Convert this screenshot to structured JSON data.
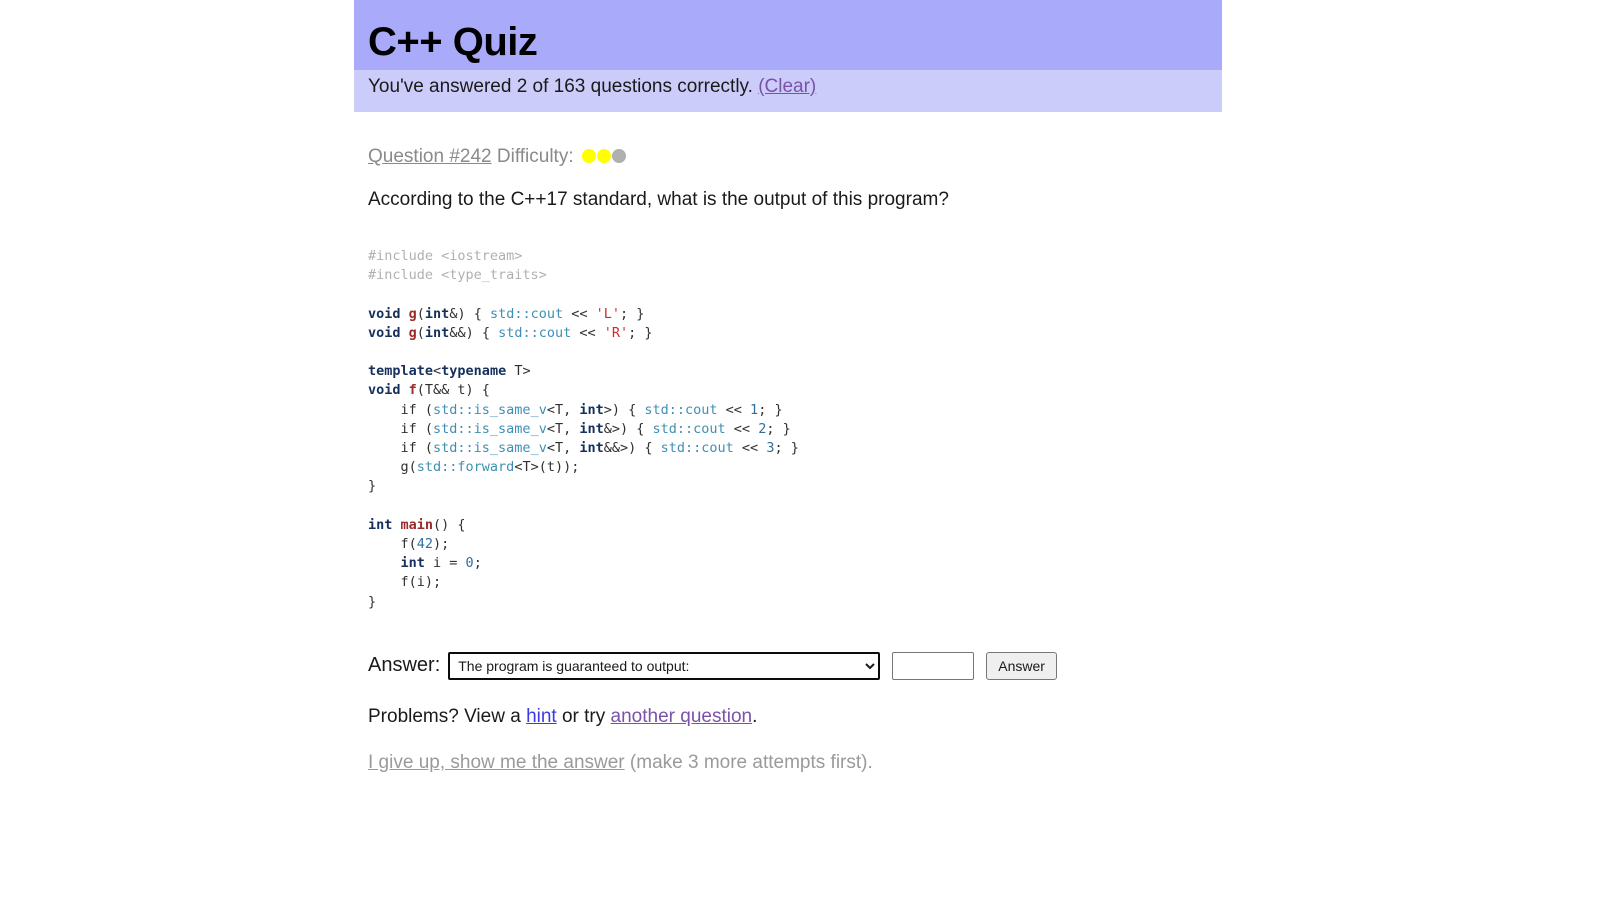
{
  "header": {
    "title": "C++ Quiz",
    "status_prefix": "You've answered 2 of 163 questions correctly.",
    "clear_label": "(Clear)",
    "correct_count": "2",
    "total_count": "163",
    "title_bg": "#aaaafa",
    "status_bg": "#ccccfa"
  },
  "question": {
    "link_label": "Question #242",
    "number": "242",
    "difficulty_label": "Difficulty:",
    "difficulty_filled": 2,
    "difficulty_total": 3,
    "difficulty_on_color": "#ffff00",
    "difficulty_off_color": "#b0b0b0",
    "prompt": "According to the C++17 standard, what is the output of this program?",
    "code_lines": [
      [
        {
          "t": "#include <iostream>",
          "c": "c-pre"
        }
      ],
      [
        {
          "t": "#include <type_traits>",
          "c": "c-pre"
        }
      ],
      [
        {
          "t": "",
          "c": "c-pl"
        }
      ],
      [
        {
          "t": "void ",
          "c": "c-kw"
        },
        {
          "t": "g",
          "c": "c-fn"
        },
        {
          "t": "(",
          "c": "c-pl"
        },
        {
          "t": "int",
          "c": "c-kw"
        },
        {
          "t": "&) { ",
          "c": "c-pl"
        },
        {
          "t": "std::cout",
          "c": "c-std"
        },
        {
          "t": " << ",
          "c": "c-pl"
        },
        {
          "t": "'L'",
          "c": "c-str"
        },
        {
          "t": "; }",
          "c": "c-pl"
        }
      ],
      [
        {
          "t": "void ",
          "c": "c-kw"
        },
        {
          "t": "g",
          "c": "c-fn"
        },
        {
          "t": "(",
          "c": "c-pl"
        },
        {
          "t": "int",
          "c": "c-kw"
        },
        {
          "t": "&&) { ",
          "c": "c-pl"
        },
        {
          "t": "std::cout",
          "c": "c-std"
        },
        {
          "t": " << ",
          "c": "c-pl"
        },
        {
          "t": "'R'",
          "c": "c-str"
        },
        {
          "t": "; }",
          "c": "c-pl"
        }
      ],
      [
        {
          "t": "",
          "c": "c-pl"
        }
      ],
      [
        {
          "t": "template",
          "c": "c-kw"
        },
        {
          "t": "<",
          "c": "c-pl"
        },
        {
          "t": "typename",
          "c": "c-kw"
        },
        {
          "t": " T>",
          "c": "c-pl"
        }
      ],
      [
        {
          "t": "void ",
          "c": "c-kw"
        },
        {
          "t": "f",
          "c": "c-fn"
        },
        {
          "t": "(T&& t) {",
          "c": "c-pl"
        }
      ],
      [
        {
          "t": "    if (",
          "c": "c-pl"
        },
        {
          "t": "std::is_same_v",
          "c": "c-std"
        },
        {
          "t": "<T, ",
          "c": "c-pl"
        },
        {
          "t": "int",
          "c": "c-kw"
        },
        {
          "t": ">) { ",
          "c": "c-pl"
        },
        {
          "t": "std::cout",
          "c": "c-std"
        },
        {
          "t": " << ",
          "c": "c-pl"
        },
        {
          "t": "1",
          "c": "c-num"
        },
        {
          "t": "; }",
          "c": "c-pl"
        }
      ],
      [
        {
          "t": "    if (",
          "c": "c-pl"
        },
        {
          "t": "std::is_same_v",
          "c": "c-std"
        },
        {
          "t": "<T, ",
          "c": "c-pl"
        },
        {
          "t": "int",
          "c": "c-kw"
        },
        {
          "t": "&>) { ",
          "c": "c-pl"
        },
        {
          "t": "std::cout",
          "c": "c-std"
        },
        {
          "t": " << ",
          "c": "c-pl"
        },
        {
          "t": "2",
          "c": "c-num"
        },
        {
          "t": "; }",
          "c": "c-pl"
        }
      ],
      [
        {
          "t": "    if (",
          "c": "c-pl"
        },
        {
          "t": "std::is_same_v",
          "c": "c-std"
        },
        {
          "t": "<T, ",
          "c": "c-pl"
        },
        {
          "t": "int",
          "c": "c-kw"
        },
        {
          "t": "&&>) { ",
          "c": "c-pl"
        },
        {
          "t": "std::cout",
          "c": "c-std"
        },
        {
          "t": " << ",
          "c": "c-pl"
        },
        {
          "t": "3",
          "c": "c-num"
        },
        {
          "t": "; }",
          "c": "c-pl"
        }
      ],
      [
        {
          "t": "    g(",
          "c": "c-pl"
        },
        {
          "t": "std::forward",
          "c": "c-std"
        },
        {
          "t": "<T>(t));",
          "c": "c-pl"
        }
      ],
      [
        {
          "t": "}",
          "c": "c-pl"
        }
      ],
      [
        {
          "t": "",
          "c": "c-pl"
        }
      ],
      [
        {
          "t": "int ",
          "c": "c-kw"
        },
        {
          "t": "main",
          "c": "c-fn"
        },
        {
          "t": "() {",
          "c": "c-pl"
        }
      ],
      [
        {
          "t": "    f(",
          "c": "c-pl"
        },
        {
          "t": "42",
          "c": "c-num"
        },
        {
          "t": ");",
          "c": "c-pl"
        }
      ],
      [
        {
          "t": "    ",
          "c": "c-pl"
        },
        {
          "t": "int",
          "c": "c-kw"
        },
        {
          "t": " i = ",
          "c": "c-pl"
        },
        {
          "t": "0",
          "c": "c-num"
        },
        {
          "t": ";",
          "c": "c-pl"
        }
      ],
      [
        {
          "t": "    f(i);",
          "c": "c-pl"
        }
      ],
      [
        {
          "t": "}",
          "c": "c-pl"
        }
      ]
    ]
  },
  "answer": {
    "label": "Answer:",
    "selected_option": "The program is guaranteed to output:",
    "options": [
      "The program is guaranteed to output:"
    ],
    "input_value": "",
    "input_placeholder": "",
    "button_label": "Answer"
  },
  "footer": {
    "problems_prefix": "Problems? View a",
    "hint_label": "hint",
    "problems_middle": "or try",
    "another_question_label": "another question",
    "problems_suffix": ".",
    "giveup_label": "I give up, show me the answer",
    "giveup_suffix": "(make 3 more attempts first)."
  }
}
